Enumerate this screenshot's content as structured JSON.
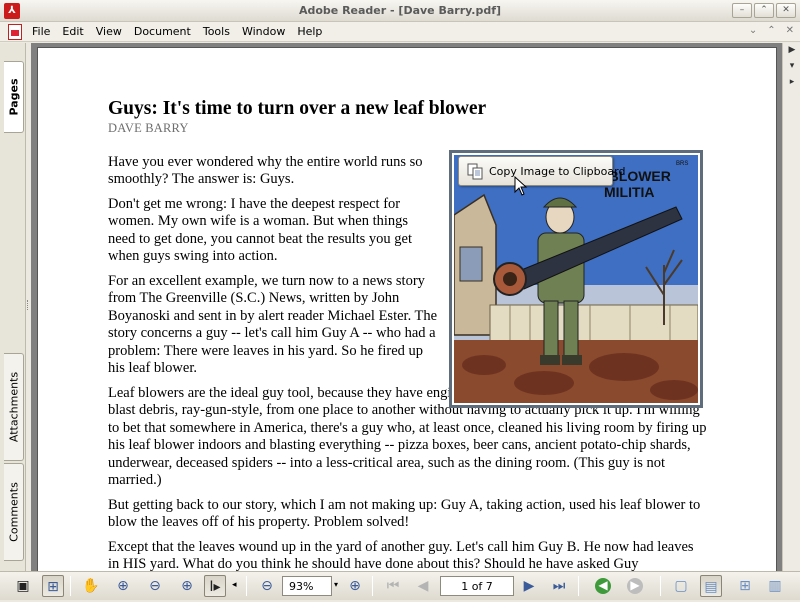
{
  "window": {
    "title": "Adobe Reader - [Dave Barry.pdf]",
    "app_icon": "adobe-reader-icon",
    "controls": [
      "minimize",
      "restore",
      "close"
    ]
  },
  "menubar": {
    "items": [
      "File",
      "Edit",
      "View",
      "Document",
      "Tools",
      "Window",
      "Help"
    ]
  },
  "side_tabs": {
    "pages": "Pages",
    "attachments": "Attachments",
    "comments": "Comments"
  },
  "article": {
    "headline": "Guys: It's time to turn over a new leaf blower",
    "byline": "DAVE BARRY",
    "paragraphs": [
      "Have you ever wondered why the entire world runs so smoothly? The answer is: Guys.",
      "Don't get me wrong: I have the deepest respect for women. My own wife is a woman. But when things need to get done, you cannot beat the results you get when guys swing into action.",
      "For an excellent example, we turn now to a news story from The Greenville (S.C.) News, written by John Boyanoski and sent in by alert reader Michael Ester. The story concerns a guy -- let's call him Guy A -- who had a problem: There were leaves in his yard. So he fired up his leaf blower.",
      "Leaf blowers are the ideal guy tool, because they have engines, they're loud, and they enable you to blast debris, ray-gun-style, from one place to another without having to actually pick it up. I'm willing to bet that somewhere in America, there's a guy who, at least once, cleaned his living room by firing up his leaf blower indoors and blasting everything -- pizza boxes, beer cans, ancient potato-chip shards, underwear, deceased spiders -- into a less-critical area, such as the dining room. (This guy is not married.)",
      "But getting back to our story, which I am not making up: Guy A, taking action, used his leaf blower to blow the leaves off of his property. Problem solved!",
      "Except that the leaves wound up in the yard of another guy. Let's call him Guy B. He now had leaves in HIS yard. What do you think he should have done about this? Should he have asked Guy"
    ],
    "cartoon_caption": "-BLOWER MILITIA",
    "cartoon_signature": "BRS"
  },
  "popup": {
    "copy_image_label": "Copy Image to Clipboard"
  },
  "toolbar": {
    "zoom_value": "93%",
    "page_display": "1 of 7",
    "icons": [
      "screen-icon",
      "snapshot-icon",
      "hand-icon",
      "zoom-in-tool-icon",
      "zoom-out-tool-icon",
      "dynamic-zoom-icon",
      "select-text-icon",
      "zoom-out-icon",
      "zoom-in-icon",
      "first-page-icon",
      "previous-page-icon",
      "next-page-icon",
      "last-page-icon",
      "go-back-icon",
      "go-forward-icon",
      "single-page-icon",
      "single-continuous-icon",
      "facing-icon",
      "facing-continuous-icon"
    ]
  }
}
